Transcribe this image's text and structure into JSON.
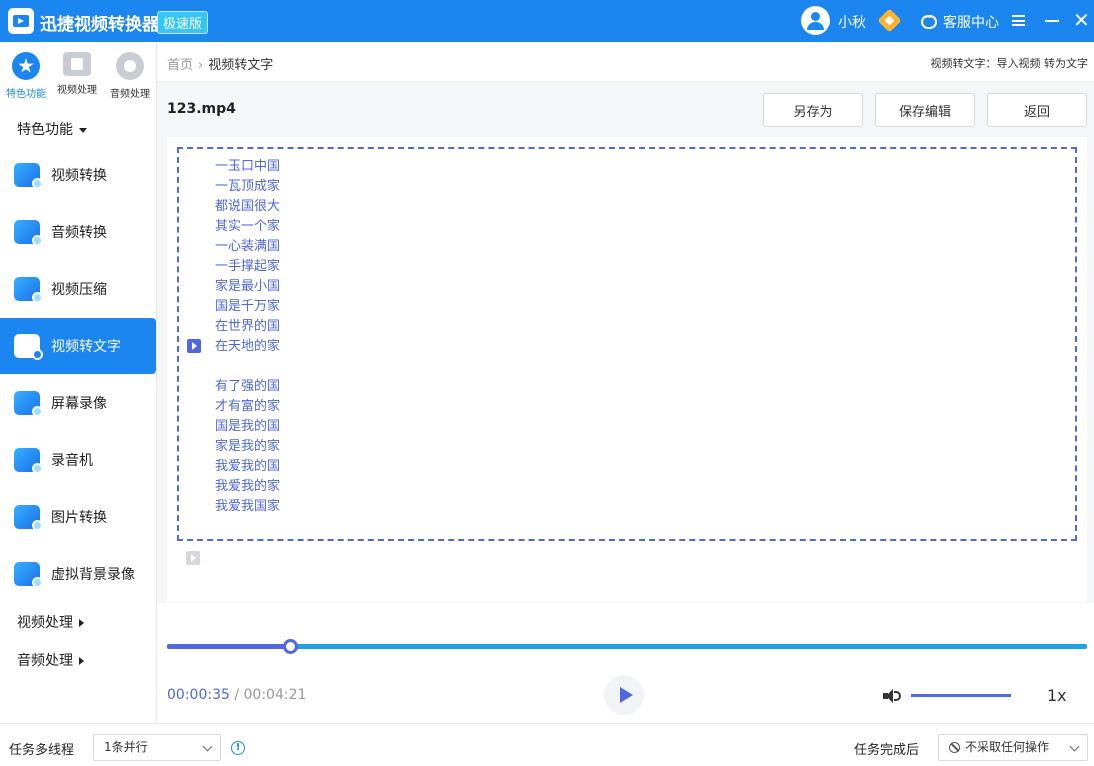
{
  "app": {
    "title": "迅捷视频转换器",
    "badge": "极速版",
    "username": "小秋",
    "support": "客服中心"
  },
  "sidebar": {
    "top_categories": [
      {
        "label": "特色功能",
        "active": true
      },
      {
        "label": "视频处理",
        "active": false
      },
      {
        "label": "音频处理",
        "active": false
      }
    ],
    "section_features": "特色功能",
    "items": [
      {
        "label": "视频转换"
      },
      {
        "label": "音频转换"
      },
      {
        "label": "视频压缩"
      },
      {
        "label": "视频转文字",
        "active": true
      },
      {
        "label": "屏幕录像"
      },
      {
        "label": "录音机"
      },
      {
        "label": "图片转换"
      },
      {
        "label": "虚拟背景录像"
      }
    ],
    "section_video": "视频处理",
    "section_audio": "音频处理"
  },
  "breadcrumb": {
    "home": "首页",
    "sep": "›",
    "current": "视频转文字"
  },
  "hint": "视频转文字：导入视频 转为文字",
  "file": {
    "name": "123.mp4"
  },
  "toolbar": {
    "save_as": "另存为",
    "save_edit": "保存编辑",
    "back": "返回"
  },
  "transcript": {
    "lines": [
      "一玉口中国",
      "一瓦顶成家",
      "都说国很大",
      "其实一个家",
      "一心装满国",
      "一手撑起家",
      "家是最小国",
      "国是千万家",
      "在世界的国",
      "在天地的家",
      "",
      "有了强的国",
      "才有富的家",
      "国是我的国",
      "家是我的家",
      "我爱我的国",
      "我爱我的家",
      "我爱我国家"
    ]
  },
  "player": {
    "current_time": "00:00:35",
    "separator": " / ",
    "total_time": "00:04:21",
    "progress": 0.134,
    "volume": 1.0,
    "speed": "1x"
  },
  "bottom": {
    "threads_label": "任务多线程",
    "threads_value": "1条并行",
    "after_label": "任务完成后",
    "after_value": "不采取任何操作"
  },
  "colors": {
    "accent": "#1b86f0",
    "primary": "#4f67e0",
    "track": "#1da2e6"
  }
}
